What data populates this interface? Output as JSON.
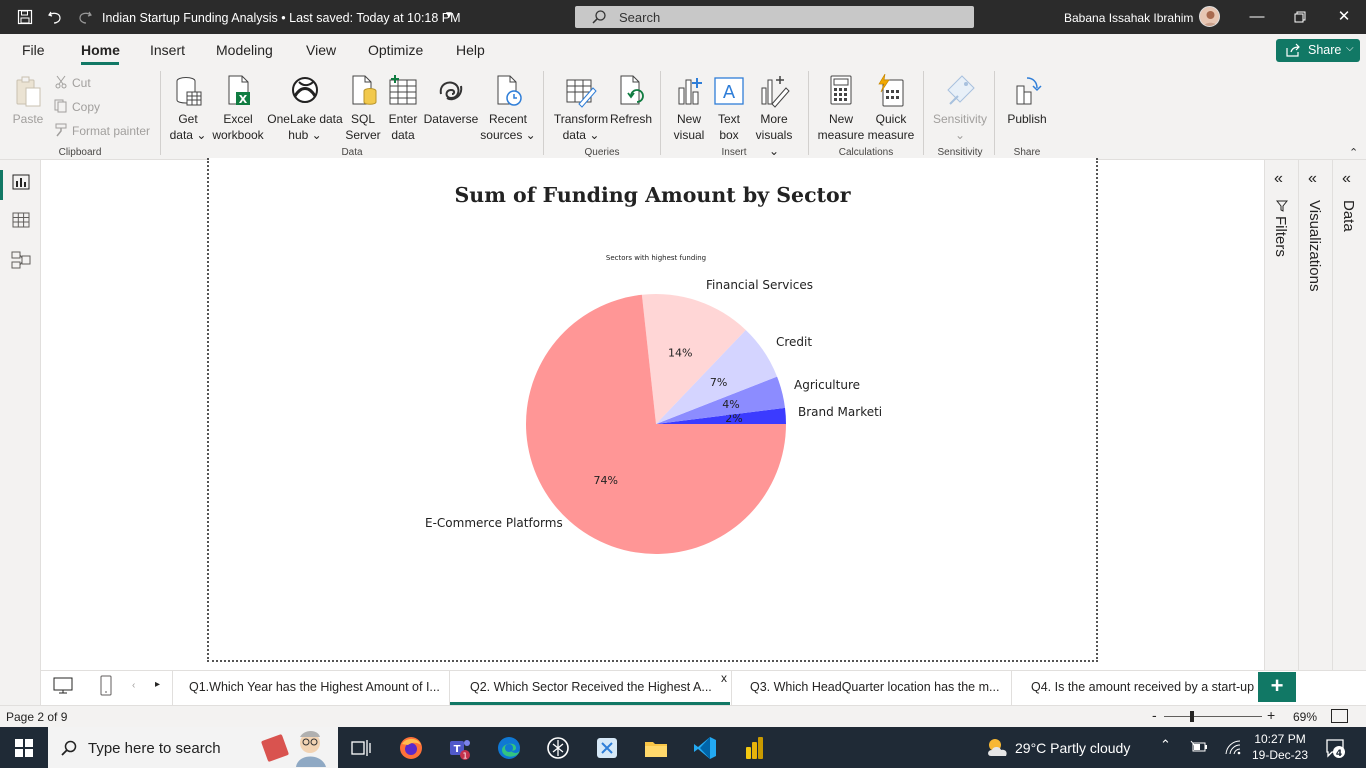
{
  "titlebar": {
    "doc_title": "Indian Startup Funding Analysis",
    "saved_status": "Last saved: Today at 10:18 PM",
    "search_placeholder": "Search",
    "user_name": "Babana Issahak Ibrahim"
  },
  "ribbon_tabs": [
    "File",
    "Home",
    "Insert",
    "Modeling",
    "View",
    "Optimize",
    "Help"
  ],
  "active_tab": "Home",
  "share_label": "Share",
  "ribbon": {
    "clipboard": {
      "paste": "Paste",
      "cut": "Cut",
      "copy": "Copy",
      "format_painter": "Format painter",
      "label": "Clipboard"
    },
    "data": {
      "get_data": [
        "Get",
        "data ⌄"
      ],
      "excel": [
        "Excel",
        "workbook"
      ],
      "onelake": [
        "OneLake data",
        "hub ⌄"
      ],
      "sql": [
        "SQL",
        "Server"
      ],
      "enter": [
        "Enter",
        "data"
      ],
      "dataverse": [
        "Dataverse",
        ""
      ],
      "recent": [
        "Recent",
        "sources ⌄"
      ],
      "label": "Data"
    },
    "queries": {
      "transform": [
        "Transform",
        "data ⌄"
      ],
      "refresh": [
        "Refresh",
        ""
      ],
      "label": "Queries"
    },
    "insert": {
      "new_visual": [
        "New",
        "visual"
      ],
      "text_box": [
        "Text",
        "box"
      ],
      "more_visuals": [
        "More",
        "visuals ⌄"
      ],
      "label": "Insert"
    },
    "calculations": {
      "new_measure": [
        "New",
        "measure"
      ],
      "quick_measure": [
        "Quick",
        "measure"
      ],
      "label": "Calculations"
    },
    "sensitivity": {
      "btn": [
        "Sensitivity",
        "⌄"
      ],
      "label": "Sensitivity"
    },
    "share": {
      "publish": [
        "Publish",
        ""
      ],
      "label": "Share"
    }
  },
  "right_panes": [
    "Filters",
    "Visualizations",
    "Data"
  ],
  "chart_data": {
    "type": "pie",
    "title": "Sum of Funding Amount by Sector",
    "subtitle": "Sectors with highest funding",
    "slices": [
      {
        "label": "Brand Marketing",
        "display_label": "Brand Marketi",
        "percent": 2,
        "color": "#3b3bff"
      },
      {
        "label": "Agriculture",
        "percent": 4,
        "color": "#8c8cff"
      },
      {
        "label": "Credit",
        "percent": 7,
        "color": "#d4d4ff"
      },
      {
        "label": "Financial Services",
        "percent": 14,
        "color": "#ffd6d6"
      },
      {
        "label": "E-Commerce Platforms",
        "percent": 74,
        "color": "#ff9696"
      }
    ]
  },
  "page_tabs": [
    "Q1.Which Year has the Highest Amount of I...",
    "Q2. Which Sector Received the Highest A...",
    "Q3. Which HeadQuarter location has the m...",
    "Q4. Is the amount received by a start-up in"
  ],
  "active_page_index": 1,
  "page_tab_close": "x",
  "add_page": "+",
  "status": {
    "page": "Page 2 of 9",
    "zoom": "69%",
    "zoom_level": 0.29
  },
  "taskbar": {
    "search_placeholder": "Type here to search",
    "weather": "29°C  Partly cloudy",
    "time": "10:27 PM",
    "date": "19-Dec-23",
    "notifications": "4",
    "teams_badge": "1"
  }
}
